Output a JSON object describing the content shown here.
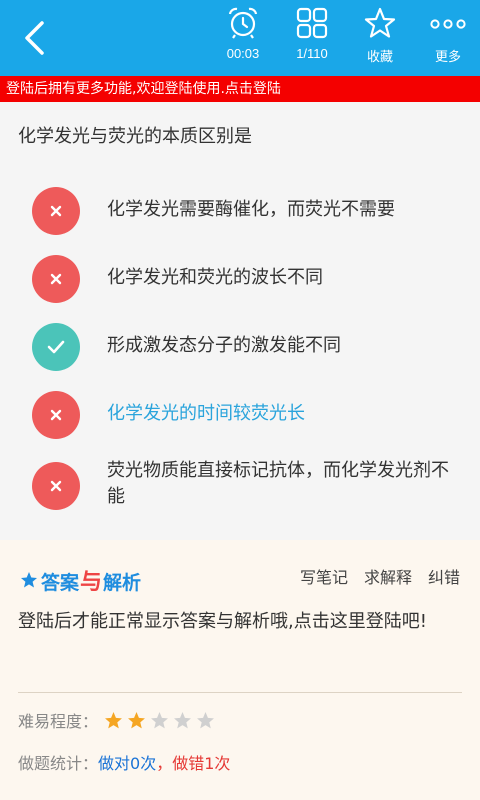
{
  "toolbar": {
    "timer": "00:03",
    "progress": "1/110",
    "favorite_label": "收藏",
    "more_label": "更多"
  },
  "notice": "登陆后拥有更多功能,欢迎登陆使用.点击登陆",
  "question": "化学发光与荧光的本质区别是",
  "options": [
    {
      "text": "化学发光需要酶催化，而荧光不需要",
      "state": "wrong"
    },
    {
      "text": "化学发光和荧光的波长不同",
      "state": "wrong"
    },
    {
      "text": "形成激发态分子的激发能不同",
      "state": "right"
    },
    {
      "text": "化学发光的时间较荧光长",
      "state": "wrong"
    },
    {
      "text": "荧光物质能直接标记抗体，而化学发光剂不能",
      "state": "wrong"
    }
  ],
  "answer": {
    "logo_left": "答案",
    "logo_mid": "与",
    "logo_right": "解析",
    "actions": [
      "写笔记",
      "求解释",
      "纠错"
    ],
    "message": "登陆后才能正常显示答案与解析哦,点击这里登陆吧!",
    "difficulty_label": "难易程度：",
    "difficulty_rating": 2,
    "difficulty_max": 5,
    "stats_label": "做题统计：",
    "stats_right": "做对0次",
    "stats_sep": "，",
    "stats_wrong": "做错1次"
  },
  "colors": {
    "header": "#1aa7e8",
    "notice": "#f40000",
    "wrong": "#ee5a5a",
    "right": "#4bc4b9",
    "highlight": "#2aa4dc",
    "star_on": "#f5a623",
    "star_off": "#d0d0d0"
  }
}
